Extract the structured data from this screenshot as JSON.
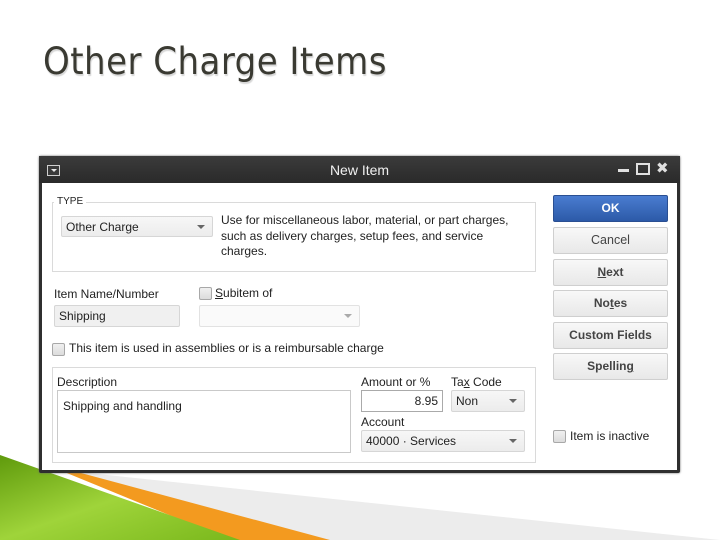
{
  "slide": {
    "title": "Other Charge Items",
    "colors": {
      "green": "#7fb61a",
      "orange": "#f39a1f",
      "grey": "#ebebeb"
    }
  },
  "dialog": {
    "title": "New Item",
    "window_controls": [
      "minimize-icon",
      "maximize-icon",
      "close-icon"
    ],
    "type_group": {
      "legend": "TYPE",
      "selected_type": "Other Charge",
      "description": "Use for miscellaneous labor, material, or part charges, such as delivery charges, setup fees, and service charges."
    },
    "item_name": {
      "label": "Item Name/Number",
      "value": "Shipping"
    },
    "subitem": {
      "label_pre": "",
      "label_underline": "S",
      "label_post": "ubitem of",
      "checked": false,
      "value": ""
    },
    "assemblies_checkbox": {
      "label": "This item is used in assemblies or is a reimbursable charge",
      "checked": false
    },
    "description": {
      "label": "Description",
      "value": "Shipping and handling"
    },
    "amount": {
      "label": "Amount or %",
      "value": "8.95"
    },
    "tax_code": {
      "label_pre": "Ta",
      "label_underline": "x",
      "label_post": " Code",
      "value": "Non"
    },
    "account": {
      "label": "Account",
      "value": "40000 · Services"
    },
    "buttons": {
      "ok": "OK",
      "cancel": "Cancel",
      "next": {
        "underline": "N",
        "rest": "ext"
      },
      "notes": {
        "pre": "No",
        "underline": "t",
        "post": "es"
      },
      "custom_fields": "Custom Fields",
      "spelling": {
        "pre": "Spellin",
        "underline": "g"
      }
    },
    "inactive_checkbox": {
      "label": "Item is inactive",
      "checked": false
    },
    "colors": {
      "ok_button": "#3a6bbf",
      "titlebar": "#333333"
    }
  }
}
